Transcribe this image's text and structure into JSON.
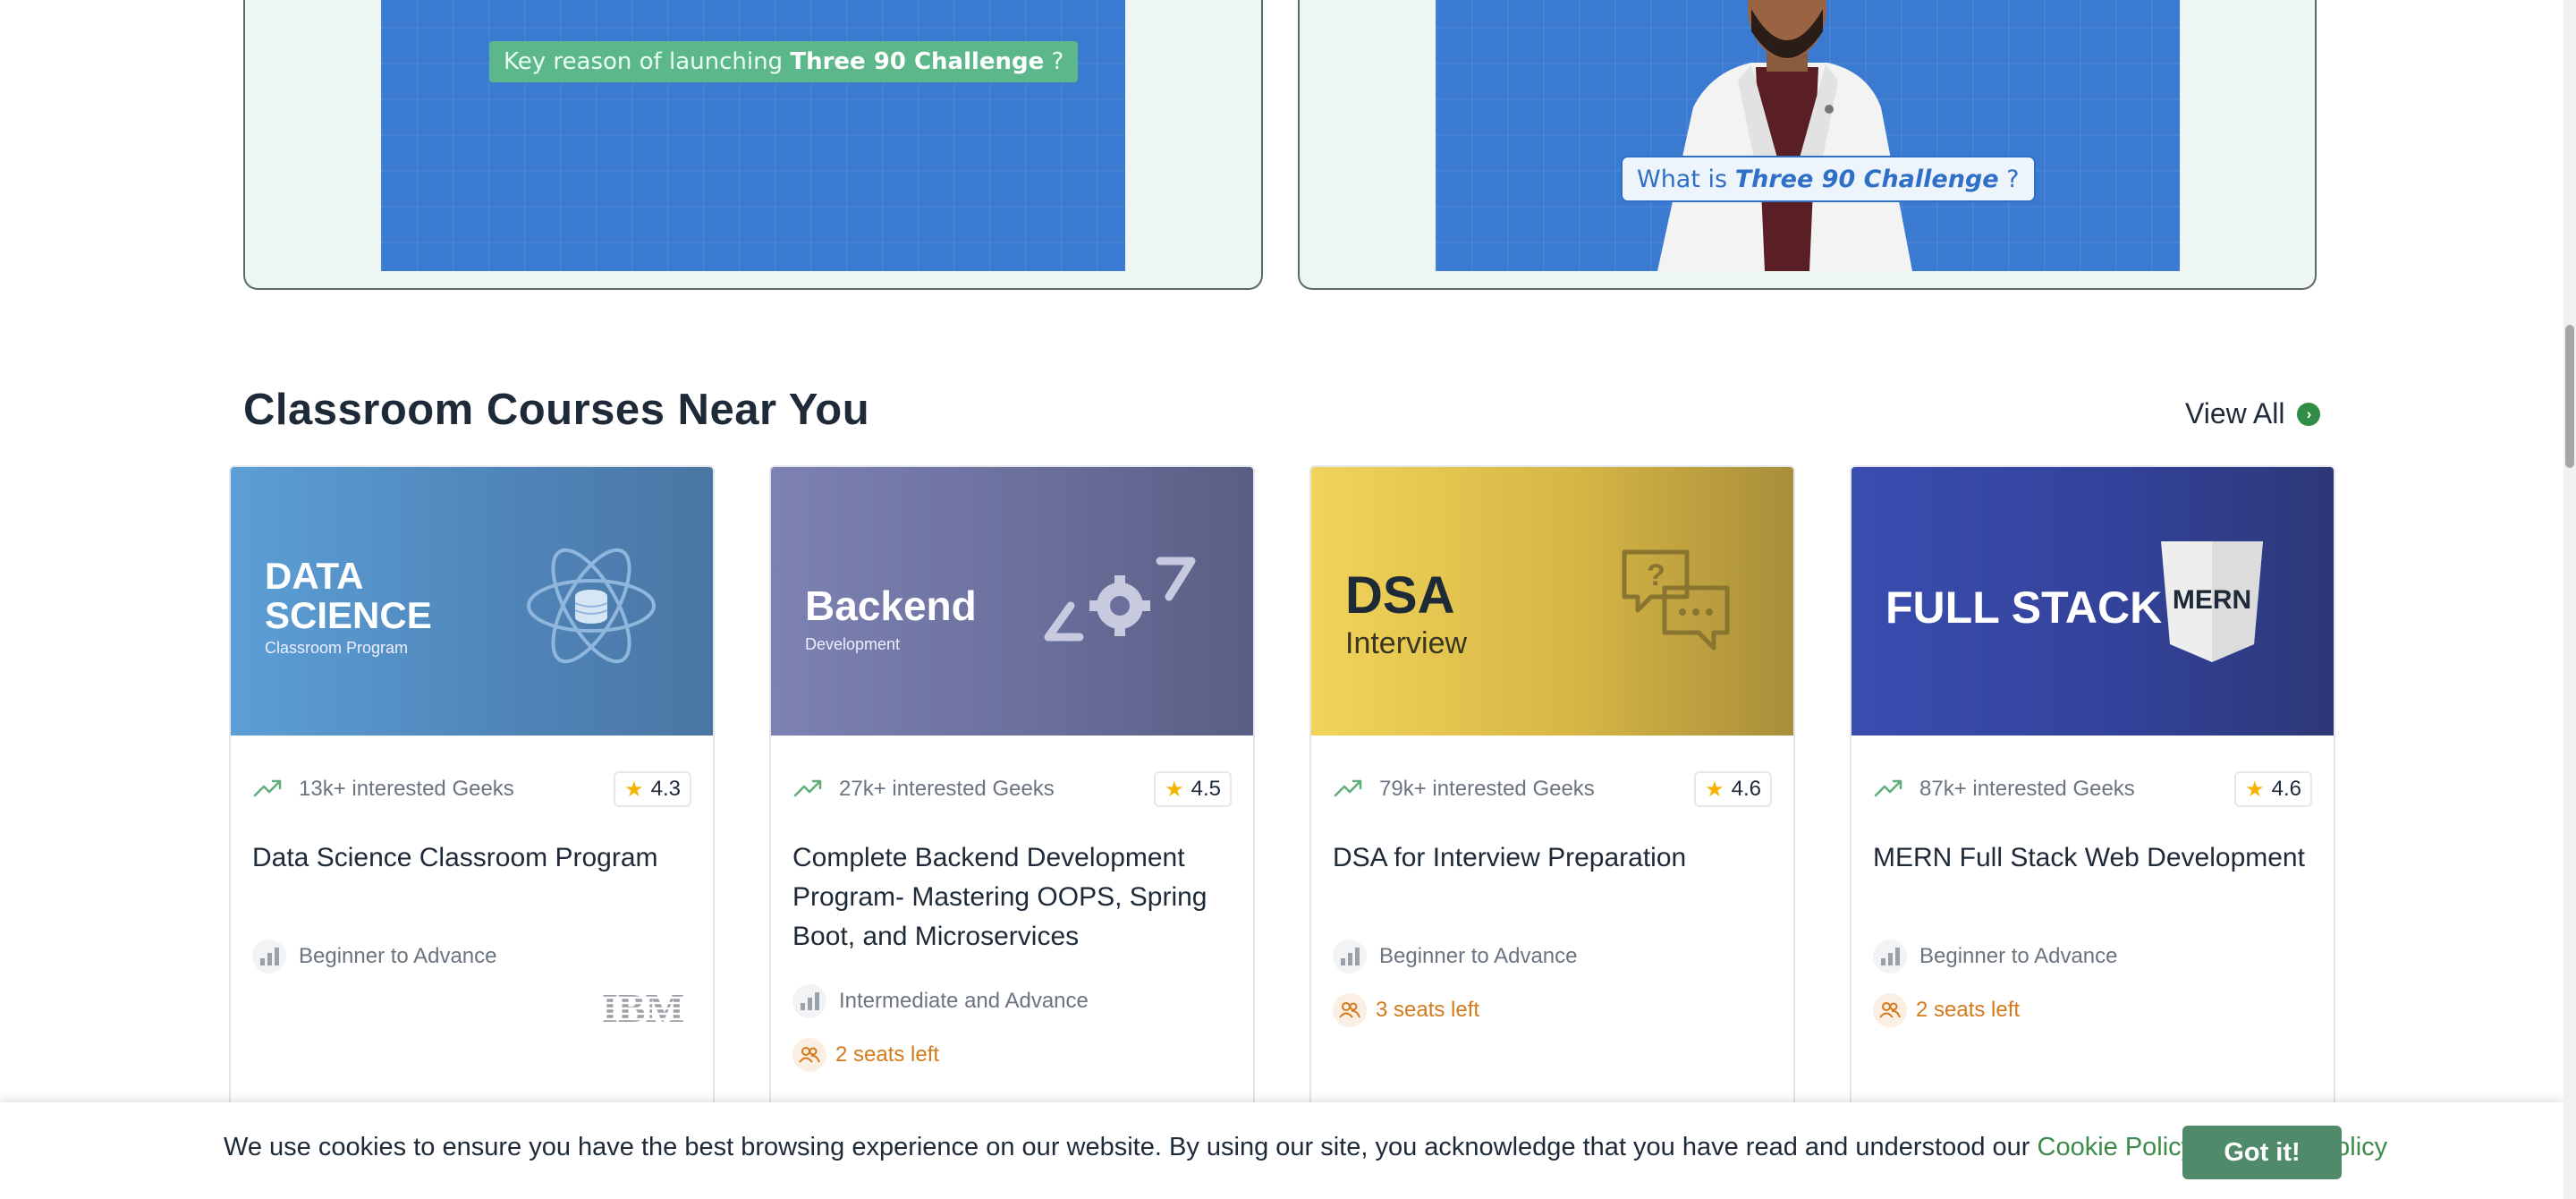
{
  "videos": [
    {
      "caption_pre": "Key reason of launching ",
      "caption_bold": "Three 90 Challenge",
      "caption_post": " ?"
    },
    {
      "caption_pre": "What is ",
      "caption_bold": "Three 90 Challenge",
      "caption_post": " ?"
    }
  ],
  "section": {
    "title": "Classroom Courses Near You",
    "view_all": "View All",
    "accent": "#2f8d46"
  },
  "courses": [
    {
      "banner_line1": "DATA",
      "banner_line2": "SCIENCE",
      "banner_sub": "Classroom Program",
      "interested": "13k+ interested Geeks",
      "rating": "4.3",
      "title": "Data Science Classroom Program",
      "level": "Beginner to Advance",
      "seats": "",
      "partner_logo": "IBM"
    },
    {
      "banner_line1": "Backend",
      "banner_sub": "Development",
      "interested": "27k+ interested Geeks",
      "rating": "4.5",
      "title": "Complete Backend Development Program- Mastering OOPS, Spring Boot, and Microservices",
      "level": "Intermediate and Advance",
      "seats": "2 seats left"
    },
    {
      "banner_line1": "DSA",
      "banner_sub": "Interview",
      "interested": "79k+ interested Geeks",
      "rating": "4.6",
      "title": "DSA for Interview Preparation",
      "level": "Beginner to Advance",
      "seats": "3 seats left"
    },
    {
      "banner_line1": "FULL STACK",
      "banner_badge": "MERN",
      "interested": "87k+ interested Geeks",
      "rating": "4.6",
      "title": "MERN Full Stack Web Development",
      "level": "Beginner to Advance",
      "seats": "2 seats left"
    }
  ],
  "cookie": {
    "text": "We use cookies to ensure you have the best browsing experience on our website. By using our site, you acknowledge that you have read and understood our ",
    "cookie_policy": "Cookie Policy",
    "amp": " & ",
    "privacy_policy": "Privacy Policy",
    "button": "Got it!"
  },
  "icons": {
    "trend": "trending-up-icon",
    "star": "star-icon",
    "level": "bar-chart-icon",
    "seats": "people-icon",
    "view_all": "chevron-right-circle-icon"
  }
}
